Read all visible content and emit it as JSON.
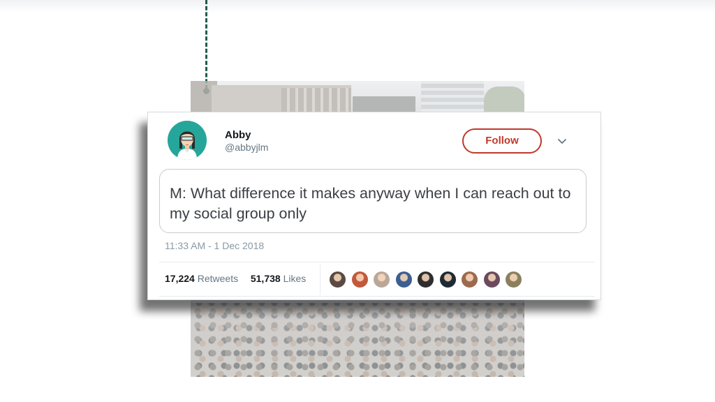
{
  "tweet": {
    "author_name": "Abby",
    "author_handle": "@abbyjlm",
    "follow_label": "Follow",
    "text": "M: What difference it makes anyway when I can reach out to my social group only",
    "timestamp": "11:33 AM - 1 Dec 2018",
    "retweets_count": "17,224",
    "retweets_label": "Retweets",
    "likes_count": "51,738",
    "likes_label": "Likes",
    "liker_avatars": [
      {
        "icon": "liker-avatar-1",
        "color": "#5a4a44"
      },
      {
        "icon": "liker-avatar-2",
        "color": "#c05a3c"
      },
      {
        "icon": "liker-avatar-3",
        "color": "#b9a89a"
      },
      {
        "icon": "liker-avatar-4",
        "color": "#3c5f8f"
      },
      {
        "icon": "liker-avatar-5",
        "color": "#2e2e30"
      },
      {
        "icon": "liker-avatar-6",
        "color": "#1e2a33"
      },
      {
        "icon": "liker-avatar-7",
        "color": "#9b6a4f"
      },
      {
        "icon": "liker-avatar-8",
        "color": "#6b4a5e"
      },
      {
        "icon": "liker-avatar-9",
        "color": "#8a8060"
      }
    ]
  },
  "colors": {
    "accent_follow": "#c0392b",
    "avatar_bg": "#26a69a",
    "connector": "#1f5b4d"
  }
}
